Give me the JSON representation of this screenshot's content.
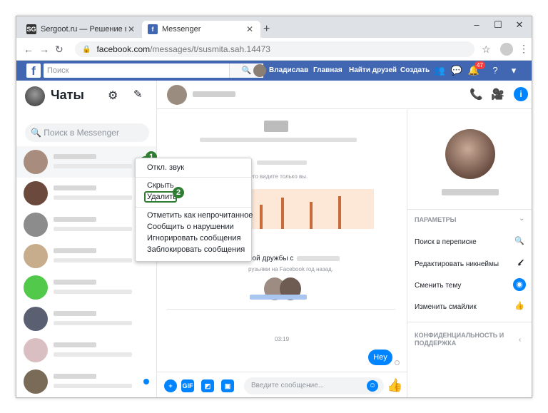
{
  "browser": {
    "tabs": [
      {
        "label": "Sergoot.ru — Решение ваших п",
        "favicon": "SG"
      },
      {
        "label": "Messenger",
        "favicon": "f"
      }
    ],
    "new_tab": "+",
    "window_controls": {
      "minimize": "–",
      "maximize": "☐",
      "close": "✕"
    },
    "url_main": "facebook.com",
    "url_path": "/messages/t/susmita.sah.14473"
  },
  "fb_bar": {
    "logo": "f",
    "search_placeholder": "Поиск",
    "nav": {
      "user": "Владислав",
      "home": "Главная",
      "find_friends": "Найти друзей",
      "create": "Создать"
    },
    "notification_count": "47"
  },
  "sidebar": {
    "title": "Чаты",
    "search_placeholder": "Поиск в Messenger"
  },
  "context_menu": {
    "mute": "Откл. звук",
    "hide": "Скрыть",
    "delete": "Удалить",
    "mark_unread": "Отметить как непрочитанное",
    "report": "Сообщить о нарушении",
    "ignore": "Игнорировать сообщения",
    "block": "Заблокировать сообщения"
  },
  "markers": {
    "one": "1",
    "two": "2"
  },
  "messages": {
    "system_note": "Это видите только вы.",
    "friendship_text": "ной дружбы с",
    "friendship_sub": "рузьями на Facebook год назад.",
    "time": "03:19",
    "sent_bubble": "Hey"
  },
  "composer": {
    "placeholder": "Введите сообщение...",
    "gif_label": "GIF"
  },
  "right_panel": {
    "params_header": "ПАРАМЕТРЫ",
    "search_in_chat": "Поиск в переписке",
    "edit_nicknames": "Редактировать никнеймы",
    "change_theme": "Сменить тему",
    "change_emoji": "Изменить смайлик",
    "privacy_header": "КОНФИДЕНЦИАЛЬНОСТЬ И ПОДДЕРЖКА"
  },
  "colors": {
    "messenger_blue": "#0084ff",
    "facebook_blue": "#4267b2",
    "marker_green": "#2e7d32"
  }
}
